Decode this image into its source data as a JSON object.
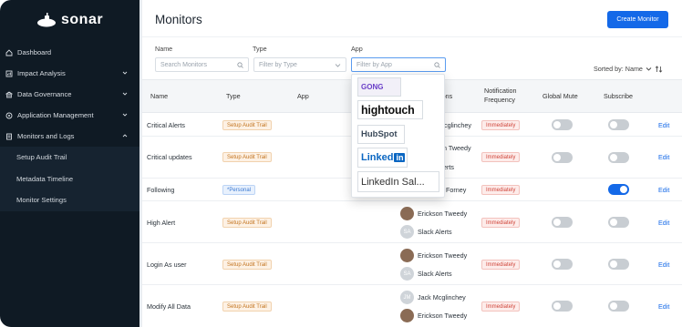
{
  "brand": {
    "name": "sonar"
  },
  "sidebar": {
    "items": [
      {
        "label": "Dashboard",
        "icon": "home-icon"
      },
      {
        "label": "Impact Analysis",
        "icon": "chart-icon"
      },
      {
        "label": "Data Governance",
        "icon": "bank-icon"
      },
      {
        "label": "Application Management",
        "icon": "gear-icon"
      },
      {
        "label": "Monitors and Logs",
        "icon": "document-icon"
      }
    ],
    "subitems": [
      {
        "label": "Setup Audit Trail"
      },
      {
        "label": "Metadata Timeline"
      },
      {
        "label": "Monitor Settings"
      }
    ]
  },
  "header": {
    "title": "Monitors",
    "create_label": "Create Monitor"
  },
  "filters": {
    "name_label": "Name",
    "name_placeholder": "Search Monitors",
    "type_label": "Type",
    "type_placeholder": "Filter by Type",
    "app_label": "App",
    "app_placeholder": "Filter by App",
    "sorted_label": "Sorted by: Name"
  },
  "table": {
    "headers": {
      "name": "Name",
      "type": "Type",
      "app": "App",
      "recipients": "ations",
      "freq1": "Notification",
      "freq2": "Frequency",
      "mute": "Global Mute",
      "subscribe": "Subscribe"
    },
    "rows": [
      {
        "name": "Critical Alerts",
        "type": "Setup Audit Trail",
        "recip1": "Mcglinchey",
        "freq": "Immediately",
        "edit": "Edit"
      },
      {
        "name": "Critical updates",
        "type": "Setup Audit Trail",
        "recip1": "n Tweedy",
        "recip2": "erts",
        "freq": "Immediately",
        "edit": "Edit"
      },
      {
        "name": "Following",
        "type": "*Personal",
        "recip1": "Forney",
        "freq": "Immediately",
        "edit": "Edit"
      },
      {
        "name": "High Alert",
        "type": "Setup Audit Trail",
        "recip1": "Erickson Tweedy",
        "recip2": "Slack Alerts",
        "freq": "Immediately",
        "edit": "Edit"
      },
      {
        "name": "Login As user",
        "type": "Setup Audit Trail",
        "recip1": "Erickson Tweedy",
        "recip2": "Slack Alerts",
        "freq": "Immediately",
        "edit": "Edit"
      },
      {
        "name": "Modify All Data",
        "type": "Setup Audit Trail",
        "recip1": "Jack Mcglinchey",
        "recip2": "Erickson Tweedy",
        "freq": "Immediately",
        "edit": "Edit"
      }
    ],
    "avatar_initials": {
      "jm": "JM",
      "sa": "SA"
    }
  },
  "dropdown": {
    "options": [
      {
        "label": "GONG"
      },
      {
        "label": "hightouch"
      },
      {
        "label": "HubSpot"
      },
      {
        "label": "Linked",
        "suffix": "in"
      },
      {
        "label": "LinkedIn Sal..."
      }
    ]
  },
  "colors": {
    "accent": "#1469e8",
    "sidebar": "#0f1a24"
  }
}
